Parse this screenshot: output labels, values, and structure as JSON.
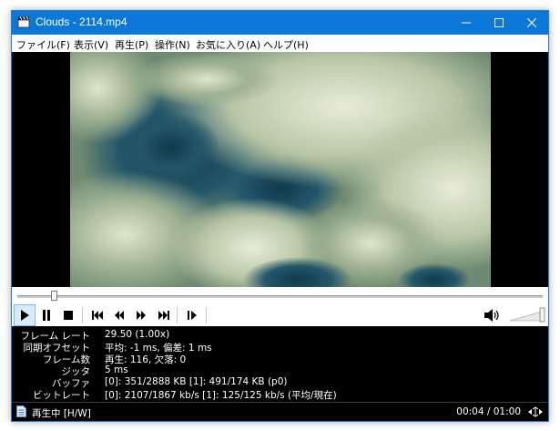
{
  "window": {
    "title": "Clouds - 2114.mp4"
  },
  "menu": [
    {
      "label": "ファイル(F)"
    },
    {
      "label": "表示(V)"
    },
    {
      "label": "再生(P)"
    },
    {
      "label": "操作(N)"
    },
    {
      "label": "お気に入り(A)"
    },
    {
      "label": "ヘルプ(H)"
    }
  ],
  "playback": {
    "position_fraction": 0.07,
    "volume_fraction": 1.0
  },
  "stats": [
    {
      "label": "フレーム レート",
      "value": "29.50 (1.00x)"
    },
    {
      "label": "同期オフセット",
      "value": "平均: -1 ms, 偏差: 1 ms"
    },
    {
      "label": "フレーム数",
      "value": "再生: 116, 欠落: 0"
    },
    {
      "label": "ジッタ",
      "value": "5 ms"
    },
    {
      "label": "バッファ",
      "value": "[0]: 351/2888 KB [1]: 491/174 KB (p0)"
    },
    {
      "label": "ビットレート",
      "value": "[0]: 2107/1867 kb/s [1]: 125/125 kb/s (平均/現在)"
    }
  ],
  "status": {
    "text": "再生中 [H/W]",
    "time": "00:04 / 01:00"
  },
  "colors": {
    "titlebar": "#0b78d7",
    "active_button": "#d9ebfa"
  }
}
